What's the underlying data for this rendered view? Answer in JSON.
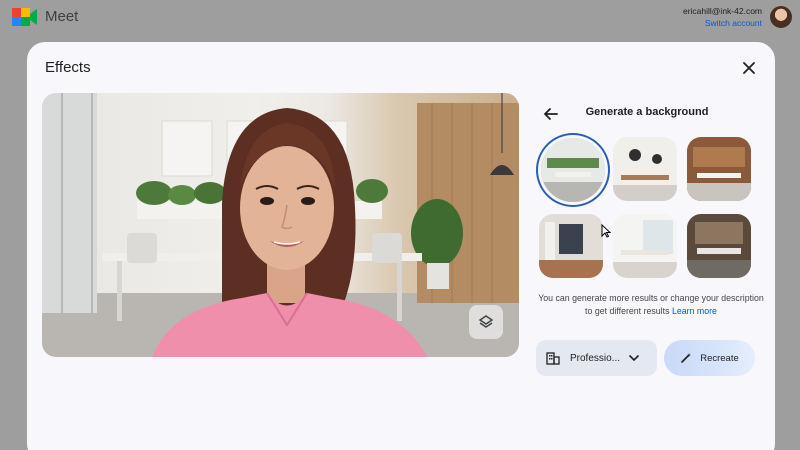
{
  "topbar": {
    "app_name": "Meet",
    "account_email": "ericahill@ink-42.com",
    "switch_account": "Switch account"
  },
  "dialog": {
    "title": "Effects",
    "close_icon": "close-icon"
  },
  "preview": {
    "layers_icon": "layers-icon"
  },
  "panel": {
    "title": "Generate a background",
    "back_icon": "arrow-back-icon",
    "thumbnails": [
      {
        "name": "office-green-wall",
        "selected": true
      },
      {
        "name": "office-round-lamps",
        "selected": false
      },
      {
        "name": "office-wood-shelves",
        "selected": false
      },
      {
        "name": "office-glass-doors",
        "selected": false
      },
      {
        "name": "office-bright-windows",
        "selected": false
      },
      {
        "name": "office-dark-meeting",
        "selected": false
      }
    ],
    "helper_text": "You can generate more results or change your description to get different results",
    "helper_link": "Learn more",
    "style_select": {
      "value": "Professio...",
      "icon": "building-icon"
    },
    "recreate_label": "Recreate",
    "recreate_icon": "magic-wand-icon"
  }
}
